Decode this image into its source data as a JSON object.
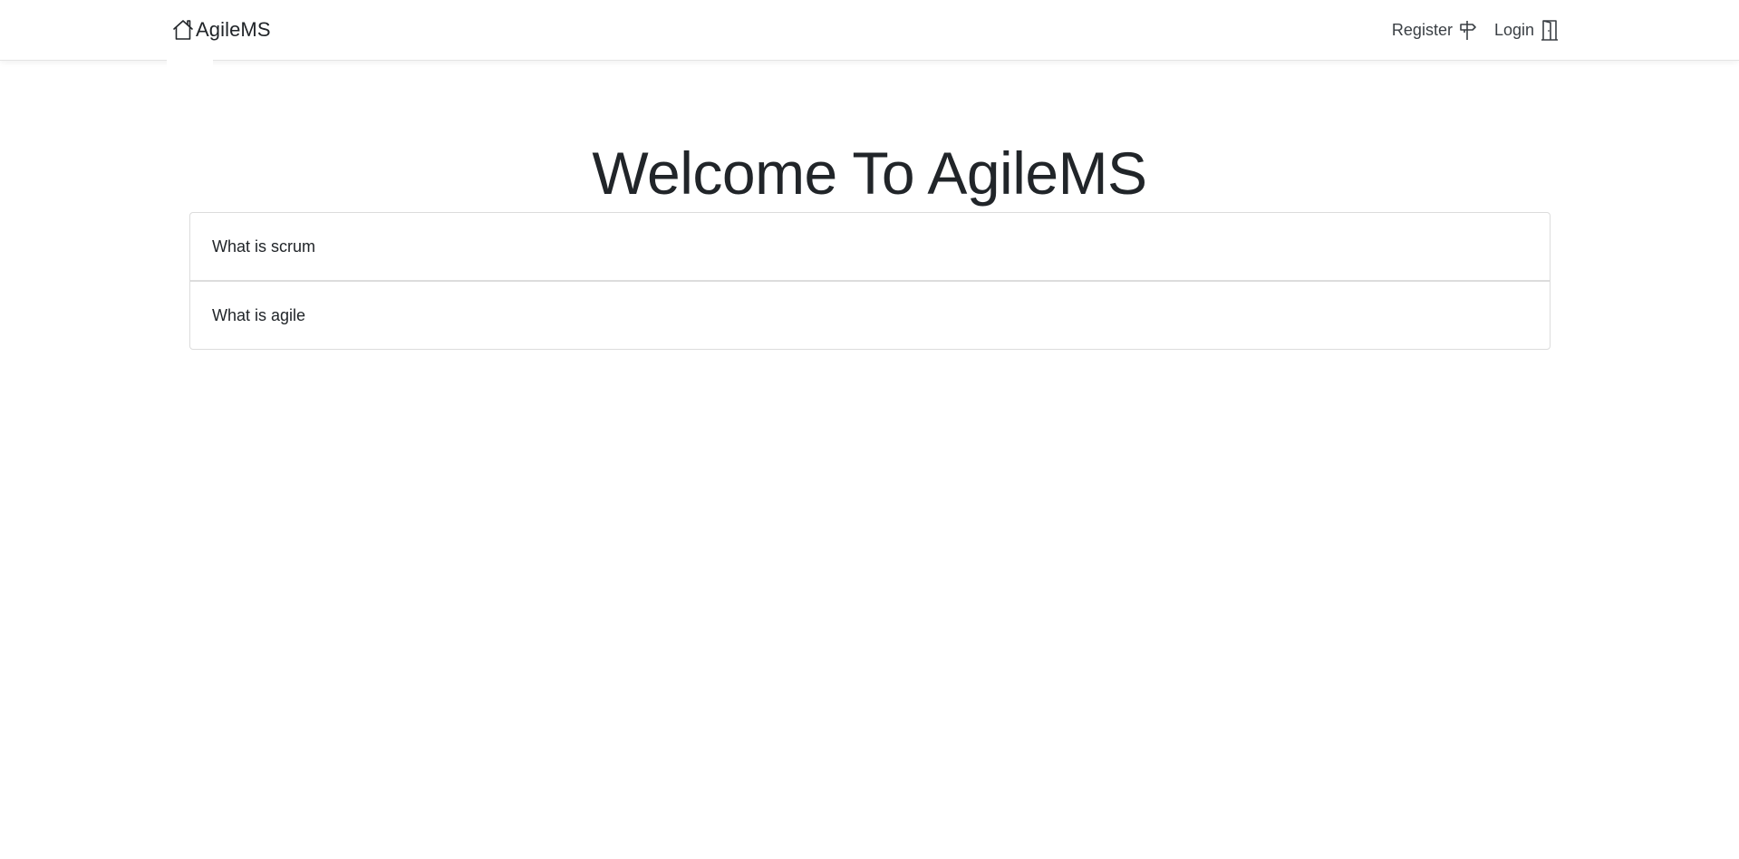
{
  "navbar": {
    "brand": {
      "icon": "house-icon",
      "label": "AgileMS"
    },
    "links": [
      {
        "label": "Register",
        "icon": "signpost-icon"
      },
      {
        "label": "Login",
        "icon": "door-icon"
      }
    ]
  },
  "main": {
    "title": "Welcome To AgileMS",
    "items": [
      {
        "label": "What is scrum"
      },
      {
        "label": "What is agile"
      }
    ]
  },
  "colors": {
    "text": "#212529",
    "border": "#dcdcdc",
    "background": "#ffffff"
  }
}
